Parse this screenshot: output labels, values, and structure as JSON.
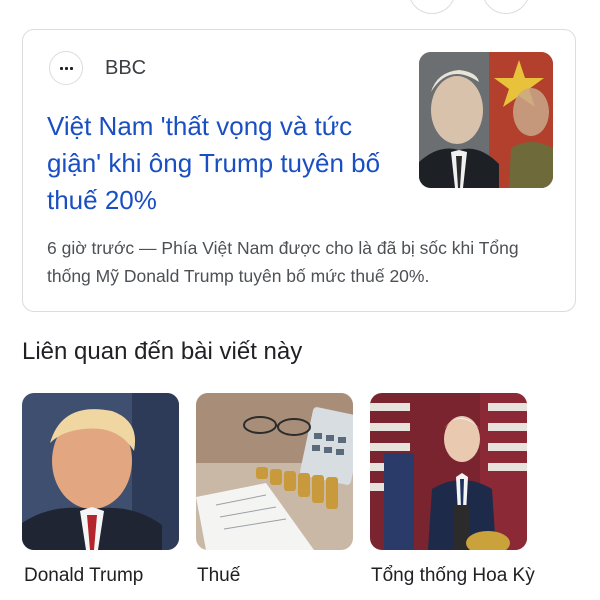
{
  "article": {
    "source": "BBC",
    "headline": "Việt Nam 'thất vọng và tức giận' khi ông Trump tuyên bố thuế 20%",
    "snippet": "6 giờ trước — Phía Việt Nam được cho là đã bị sốc khi Tổng thống Mỹ Donald Trump tuyên bố mức thuế 20%."
  },
  "related": {
    "title": "Liên quan đến bài viết này",
    "items": [
      {
        "label": "Donald Trump"
      },
      {
        "label": "Thuế"
      },
      {
        "label": "Tổng thống Hoa Kỳ"
      }
    ]
  },
  "colors": {
    "link": "#1a4fc4",
    "border": "#dadce0",
    "snippet": "#4d5156"
  }
}
